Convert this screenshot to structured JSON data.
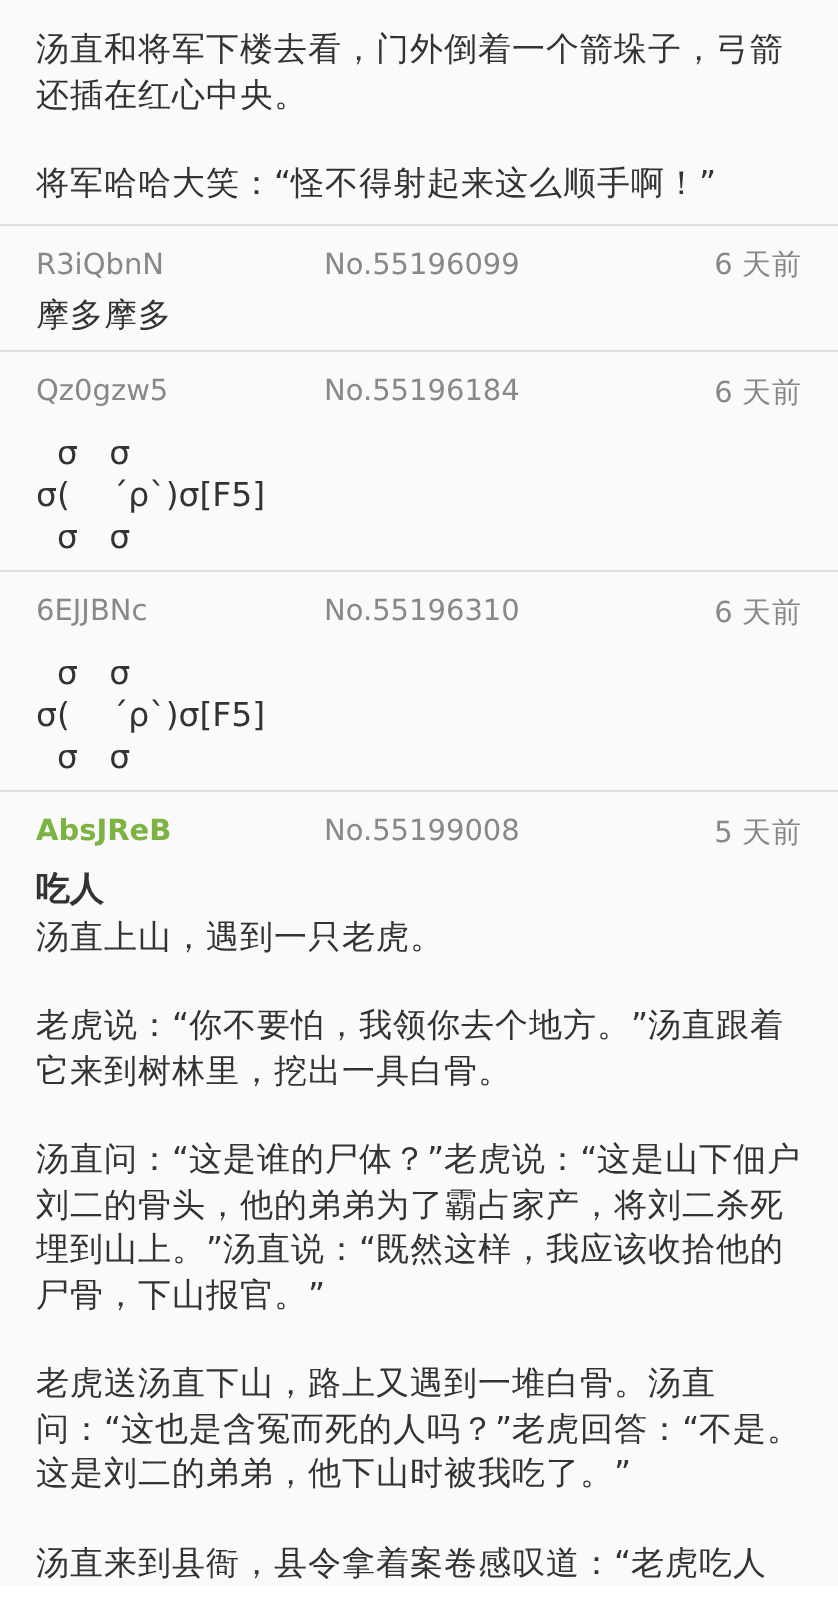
{
  "top_post": {
    "paragraphs": [
      "汤直和将军下楼去看，门外倒着一个箭垛子，弓箭还插在红心中央。",
      "将军哈哈大笑：“怪不得射起来这么顺手啊！”"
    ]
  },
  "replies": [
    {
      "uid": "R3iQbnN",
      "no": "No.55196099",
      "time": "6 天前",
      "is_po": false,
      "kind": "text",
      "paragraphs": [
        "摩多摩多"
      ]
    },
    {
      "uid": "Qz0gzw5",
      "no": "No.55196184",
      "time": "6 天前",
      "is_po": false,
      "kind": "art",
      "paragraphs": [
        "  σ   σ\nσ(    ´ρ`)σ[F5]\n  σ   σ"
      ]
    },
    {
      "uid": "6EJJBNc",
      "no": "No.55196310",
      "time": "6 天前",
      "is_po": false,
      "kind": "art",
      "paragraphs": [
        "  σ   σ\nσ(    ´ρ`)σ[F5]\n  σ   σ"
      ]
    },
    {
      "uid": "AbsJReB",
      "no": "No.55199008",
      "time": "5 天前",
      "is_po": true,
      "kind": "text",
      "title": "吃人",
      "paragraphs": [
        "汤直上山，遇到一只老虎。",
        "老虎说：“你不要怕，我领你去个地方。”汤直跟着它来到树林里，挖出一具白骨。",
        "汤直问：“这是谁的尸体？”老虎说：“这是山下佃户刘二的骨头，他的弟弟为了霸占家产，将刘二杀死埋到山上。”汤直说：“既然这样，我应该收拾他的尸骨，下山报官。”",
        "老虎送汤直下山，路上又遇到一堆白骨。汤直问：“这也是含冤而死的人吗？”老虎回答：“不是。这是刘二的弟弟，他下山时被我吃了。”",
        "汤直来到县衙，县令拿着案卷感叹道：“老虎吃人"
      ]
    }
  ]
}
